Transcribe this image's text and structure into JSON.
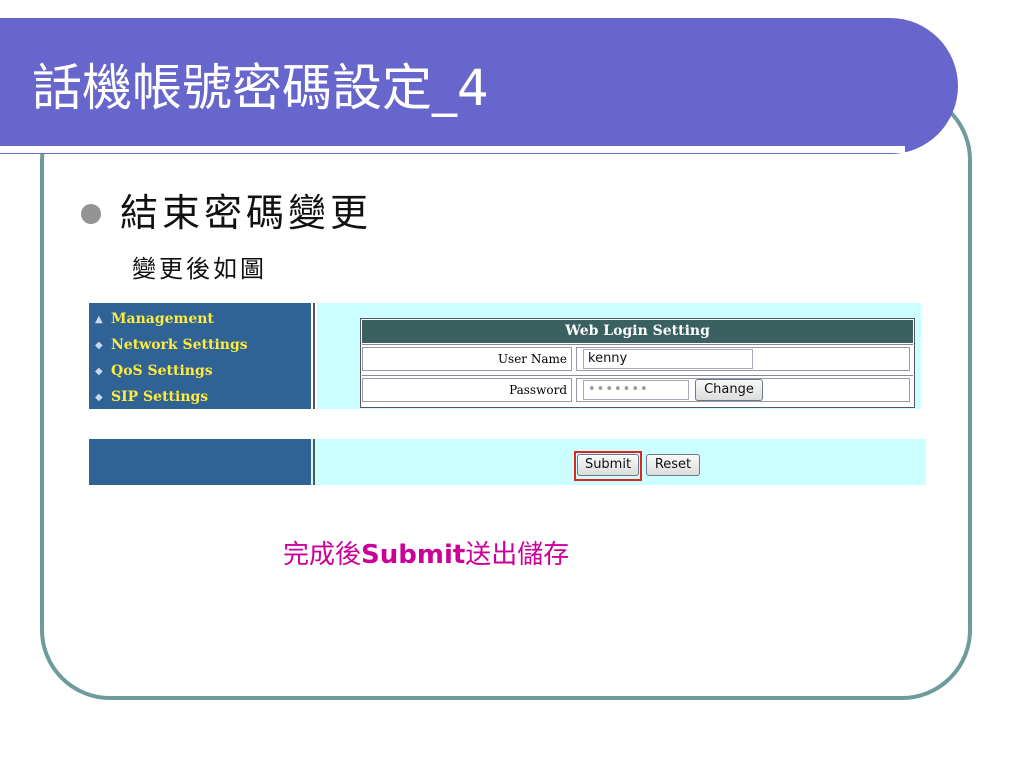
{
  "slide": {
    "title": "話機帳號密碼設定_4",
    "heading": "結束密碼變更",
    "subheading": "變更後如圖",
    "caption_pre": "完成後",
    "caption_bold": "Submit",
    "caption_post": "送出儲存"
  },
  "nav": {
    "items": [
      {
        "label": "Management",
        "icon": "triangle-up-icon"
      },
      {
        "label": "Network Settings",
        "icon": "diamond-icon"
      },
      {
        "label": "QoS Settings",
        "icon": "diamond-icon"
      },
      {
        "label": "SIP Settings",
        "icon": "diamond-icon"
      }
    ]
  },
  "form": {
    "header": "Web Login Setting",
    "username_label": "User Name",
    "username_value": "kenny",
    "password_label": "Password",
    "password_value": "•••••••",
    "change_label": "Change",
    "submit_label": "Submit",
    "reset_label": "Reset"
  },
  "colors": {
    "title_bar": "#6666cc",
    "nav_bg": "#2f6295",
    "nav_text": "#ffeb3b",
    "content_bg": "#ccffff",
    "caption": "#cc0099",
    "highlight": "#e0241e"
  }
}
